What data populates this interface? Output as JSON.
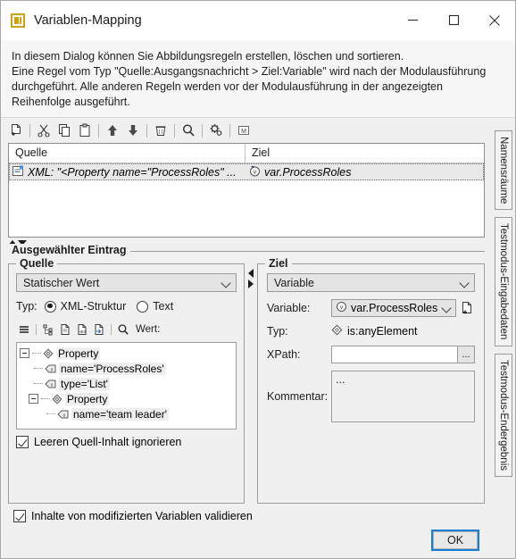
{
  "window": {
    "title": "Variablen-Mapping",
    "icon": "window-icon",
    "minimize_label": "—",
    "maximize_label": "□",
    "close_label": "✕"
  },
  "description": {
    "line1": "In diesem Dialog können Sie Abbildungsregeln erstellen, löschen und sortieren.",
    "line2": "Eine Regel vom Typ \"Quelle:Ausgangsnachricht > Ziel:Variable\" wird nach der Modulausführung durchgeführt. Alle anderen Regeln werden vor der Modulausführung in der angezeigten Reihenfolge ausgeführt."
  },
  "toolbar": {
    "items": [
      {
        "name": "new-rule-icon",
        "tooltip": "Neu"
      },
      {
        "name": "cut-icon",
        "tooltip": "Ausschneiden"
      },
      {
        "name": "copy-icon",
        "tooltip": "Kopieren"
      },
      {
        "name": "paste-icon",
        "tooltip": "Einfügen"
      },
      {
        "name": "move-up-icon",
        "tooltip": "Nach oben"
      },
      {
        "name": "move-down-icon",
        "tooltip": "Nach unten"
      },
      {
        "name": "delete-icon",
        "tooltip": "Löschen"
      },
      {
        "name": "search-icon",
        "tooltip": "Suchen"
      },
      {
        "name": "settings-icon",
        "tooltip": "Einstellungen"
      },
      {
        "name": "module-icon",
        "tooltip": "Modul"
      }
    ]
  },
  "table": {
    "columns": [
      "Quelle",
      "Ziel"
    ],
    "rows": [
      {
        "source_icon": "xml-document-icon",
        "source": "XML: \"<Property name=\"ProcessRoles\" ...",
        "target_icon": "variable-icon",
        "target": "var.ProcessRoles"
      }
    ]
  },
  "selected_entry": {
    "title": "Ausgewählter Eintrag",
    "source": {
      "title": "Quelle",
      "type_combo_value": "Statischer Wert",
      "typ_label": "Typ:",
      "radio_xml_label": "XML-Struktur",
      "radio_xml_selected": true,
      "radio_text_label": "Text",
      "radio_text_selected": false,
      "mini_toolbar": [
        {
          "name": "list-view-icon"
        },
        {
          "name": "tree-view-icon"
        },
        {
          "name": "document-icon"
        },
        {
          "name": "hex-document-icon"
        },
        {
          "name": "import-document-icon"
        },
        {
          "name": "search-icon"
        }
      ],
      "wert_label": "Wert:",
      "tree": [
        {
          "level": 0,
          "expander": true,
          "icon": "element-icon",
          "label": "Property"
        },
        {
          "level": 1,
          "expander": false,
          "icon": "attribute-icon",
          "label": "name='ProcessRoles'"
        },
        {
          "level": 1,
          "expander": false,
          "icon": "attribute-icon",
          "label": "type='List'"
        },
        {
          "level": 1,
          "expander": true,
          "icon": "element-icon",
          "label": "Property"
        },
        {
          "level": 2,
          "expander": false,
          "icon": "attribute-icon",
          "label": "name='team leader'"
        }
      ],
      "ignore_empty_label": "Leeren Quell-Inhalt ignorieren",
      "ignore_empty_checked": true
    },
    "target": {
      "title": "Ziel",
      "type_combo_value": "Variable",
      "variable_label": "Variable:",
      "variable_value": "var.ProcessRoles",
      "variable_icon": "variable-icon",
      "new_variable_icon": "new-document-icon",
      "typ_label": "Typ:",
      "typ_value": "is:anyElement",
      "typ_icon": "element-type-icon",
      "xpath_label": "XPath:",
      "xpath_value": "",
      "xpath_browse_label": "...",
      "kommentar_label": "Kommentar:",
      "kommentar_value": "..."
    }
  },
  "side_tabs": [
    {
      "label": "Namensräume"
    },
    {
      "label": "Testmodus-Eingabedaten"
    },
    {
      "label": "Testmodus-Endergebnis"
    }
  ],
  "bottom": {
    "validate_label": "Inhalte von modifizierten Variablen validieren",
    "validate_checked": true,
    "ok_label": "OK"
  },
  "colors": {
    "accent": "#1a7fd4",
    "title_icon": "#c8a415",
    "variable_icon": "#5b2d8e",
    "window_bg": "#f0f0f0"
  }
}
